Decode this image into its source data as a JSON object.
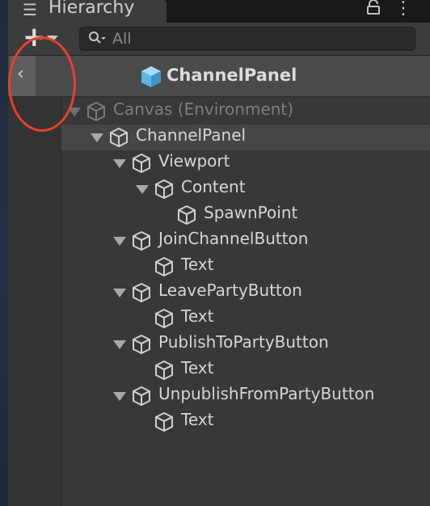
{
  "tab": {
    "title": "Hierarchy",
    "icon": "hierarchy-list-icon"
  },
  "toolbar": {
    "add_icon": "plus-icon",
    "search_placeholder": "All"
  },
  "prefab": {
    "title": "ChannelPanel",
    "icon": "prefab-cube-icon"
  },
  "colors": {
    "annotation": "#e8402e",
    "prefab_icon": "#7cc8f0",
    "background": "#383838"
  },
  "tree": [
    {
      "label": "Canvas (Environment)",
      "depth": 0,
      "expanded": true,
      "dim": true
    },
    {
      "label": "ChannelPanel",
      "depth": 1,
      "expanded": true,
      "selected": true
    },
    {
      "label": "Viewport",
      "depth": 2,
      "expanded": true
    },
    {
      "label": "Content",
      "depth": 3,
      "expanded": true
    },
    {
      "label": "SpawnPoint",
      "depth": 4,
      "expanded": false,
      "leaf": true
    },
    {
      "label": "JoinChannelButton",
      "depth": 2,
      "expanded": true
    },
    {
      "label": "Text",
      "depth": 3,
      "leaf": true
    },
    {
      "label": "LeavePartyButton",
      "depth": 2,
      "expanded": true
    },
    {
      "label": "Text",
      "depth": 3,
      "leaf": true
    },
    {
      "label": "PublishToPartyButton",
      "depth": 2,
      "expanded": true
    },
    {
      "label": "Text",
      "depth": 3,
      "leaf": true
    },
    {
      "label": "UnpublishFromPartyButton",
      "depth": 2,
      "expanded": true
    },
    {
      "label": "Text",
      "depth": 3,
      "leaf": true
    }
  ]
}
